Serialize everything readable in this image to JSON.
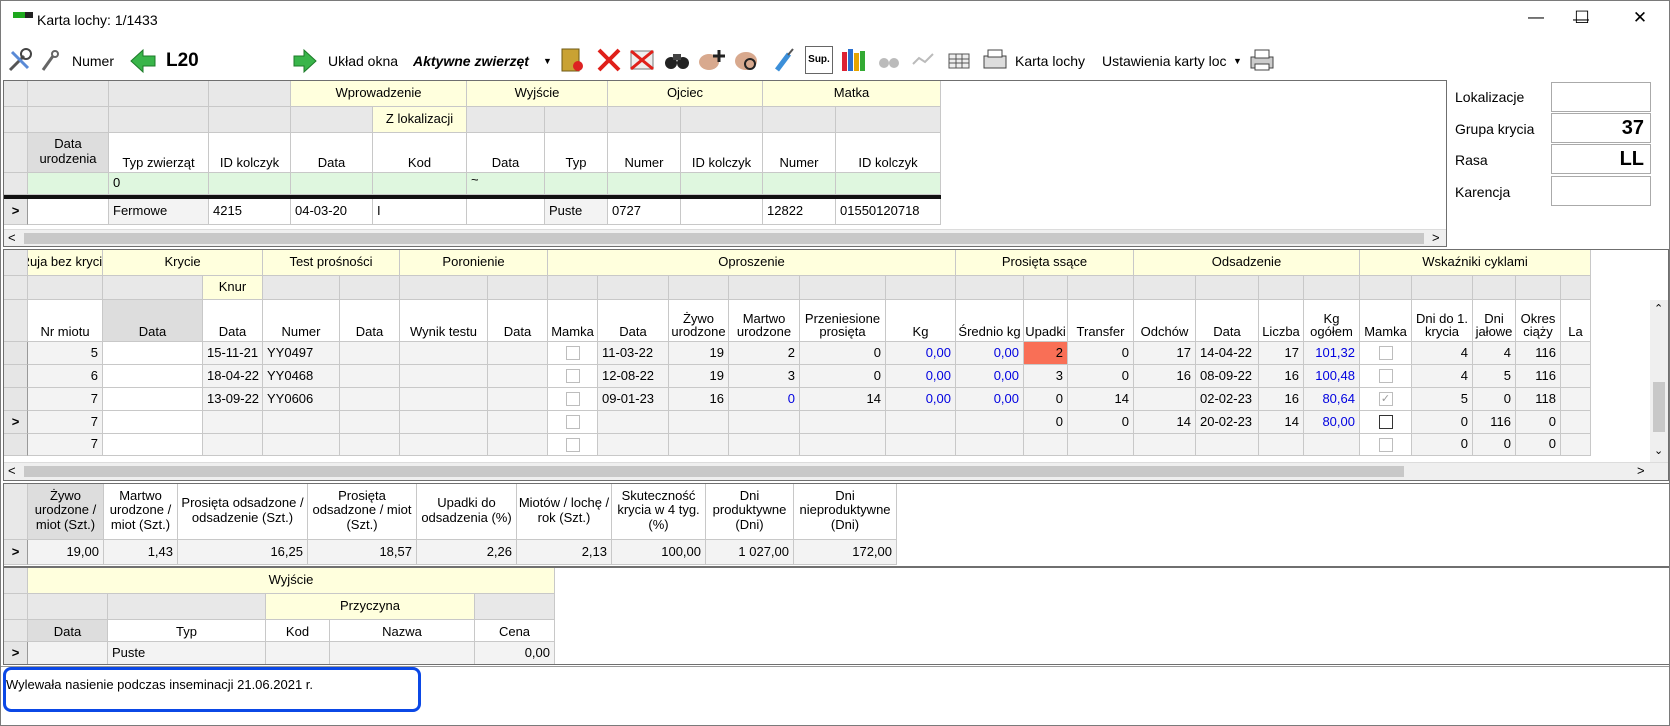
{
  "window": {
    "title": "Karta lochy: 1/1433",
    "minimize": "—",
    "maximize": "☐",
    "close": "✕"
  },
  "toolbar": {
    "numer_label": "Numer",
    "animal": "L20",
    "uklad_okna": "Układ okna",
    "aktywne": "Aktywne zwierzęt",
    "karta_lochy": "Karta lochy",
    "ustawienia": "Ustawienia karty loc",
    "sup": "Sup."
  },
  "colors": {
    "header_group": "#ffffdd",
    "highlight_red": "#f96f56",
    "new_row": "#dff7df",
    "note_border": "#0b48e6",
    "link_blue": "#0000e0"
  },
  "top_grid": {
    "groups": {
      "wprowadzenie": "Wprowadzenie",
      "z_lokalizacji": "Z lokalizacji",
      "wyjscie": "Wyjście",
      "ojciec": "Ojciec",
      "matka": "Matka"
    },
    "headers": [
      "Data urodzenia",
      "Typ zwierząt",
      "ID kolczyk",
      "Data",
      "Kod",
      "Data",
      "Typ",
      "Numer",
      "ID kolczyk",
      "Numer",
      "ID kolczyk"
    ],
    "filter_row": [
      "",
      "0",
      "",
      "",
      "",
      "~",
      "",
      "",
      "",
      "",
      ""
    ],
    "row": [
      "",
      "Fermowe",
      "4215",
      "04-03-20",
      "I",
      "",
      "Puste",
      "0727",
      "",
      "12822",
      "01550120718"
    ]
  },
  "properties": [
    {
      "label": "Lokalizacje",
      "value": ""
    },
    {
      "label": "Grupa krycia",
      "value": "37"
    },
    {
      "label": "Rasa",
      "value": "LL"
    },
    {
      "label": "Karencja",
      "value": ""
    }
  ],
  "litter_grid": {
    "groups": {
      "ruja": "Ruja bez krycia",
      "krycie": "Krycie",
      "knur": "Knur",
      "test": "Test prośności",
      "poronienie": "Poronienie",
      "oproszenie": "Oproszenie",
      "prosieta": "Prosięta ssące",
      "odsadzenie": "Odsadzenie",
      "wskazniki": "Wskaźniki cyklami"
    },
    "headers": [
      "Nr miotu",
      "Data",
      "Data",
      "Numer",
      "Data",
      "Wynik testu",
      "Data",
      "Mamka",
      "Data",
      "Żywo urodzone",
      "Martwo urodzone",
      "Przeniesione prosięta",
      "Kg",
      "Średnio kg",
      "Upadki",
      "Transfer",
      "Odchów",
      "Data",
      "Liczba",
      "Kg ogółem",
      "Mamka",
      "Dni do 1. krycia",
      "Dni jałowe",
      "Okres ciąży",
      "La"
    ],
    "rows": [
      {
        "sel": "",
        "cells": [
          "5",
          "",
          "15-11-21",
          "YY0497",
          "",
          "",
          "",
          "",
          "11-03-22",
          "19",
          "2",
          "0",
          "0,00",
          "0,00",
          "2",
          "0",
          "17",
          "14-04-22",
          "17",
          "101,32",
          "",
          "4",
          "4",
          "116",
          ""
        ]
      },
      {
        "sel": "",
        "cells": [
          "6",
          "",
          "18-04-22",
          "YY0468",
          "",
          "",
          "",
          "",
          "12-08-22",
          "19",
          "3",
          "0",
          "0,00",
          "0,00",
          "3",
          "0",
          "16",
          "08-09-22",
          "16",
          "100,48",
          "",
          "4",
          "5",
          "116",
          ""
        ]
      },
      {
        "sel": "",
        "cells": [
          "7",
          "",
          "13-09-22",
          "YY0606",
          "",
          "",
          "",
          "",
          "09-01-23",
          "16",
          "0",
          "14",
          "0,00",
          "0,00",
          "0",
          "14",
          "",
          "02-02-23",
          "16",
          "80,64",
          "",
          "5",
          "0",
          "118",
          ""
        ]
      },
      {
        "sel": ">",
        "cells": [
          "7",
          "",
          "",
          "",
          "",
          "",
          "",
          "",
          "",
          "",
          "",
          "",
          "",
          "",
          "0",
          "0",
          "14",
          "20-02-23",
          "14",
          "80,00",
          "",
          "0",
          "116",
          "0",
          ""
        ]
      },
      {
        "sel": "",
        "cells": [
          "7",
          "",
          "",
          "",
          "",
          "",
          "",
          "",
          "",
          "",
          "",
          "",
          "",
          "",
          "",
          "",
          "",
          "",
          "",
          "",
          "",
          "0",
          "0",
          "0",
          ""
        ]
      }
    ]
  },
  "stats_grid": {
    "headers": [
      "Żywo urodzone / miot (Szt.)",
      "Martwo urodzone / miot (Szt.)",
      "Prosięta odsadzone / odsadzenie (Szt.)",
      "Prosięta odsadzone / miot (Szt.)",
      "Upadki do odsadzenia (%)",
      "Miotów / lochę / rok (Szt.)",
      "Skuteczność krycia w 4 tyg. (%)",
      "Dni produktywne (Dni)",
      "Dni nieproduktywne (Dni)"
    ],
    "values": [
      "19,00",
      "1,43",
      "16,25",
      "18,57",
      "2,26",
      "2,13",
      "100,00",
      "1 027,00",
      "172,00"
    ]
  },
  "exit_grid": {
    "groups": {
      "wyjscie": "Wyjście",
      "przyczyna": "Przyczyna"
    },
    "headers": [
      "Data",
      "Typ",
      "Kod",
      "Nazwa",
      "Cena"
    ],
    "row": [
      "",
      "Puste",
      "",
      "",
      "0,00"
    ]
  },
  "note": "Wylewała nasienie podczas inseminacji 21.06.2021 r."
}
